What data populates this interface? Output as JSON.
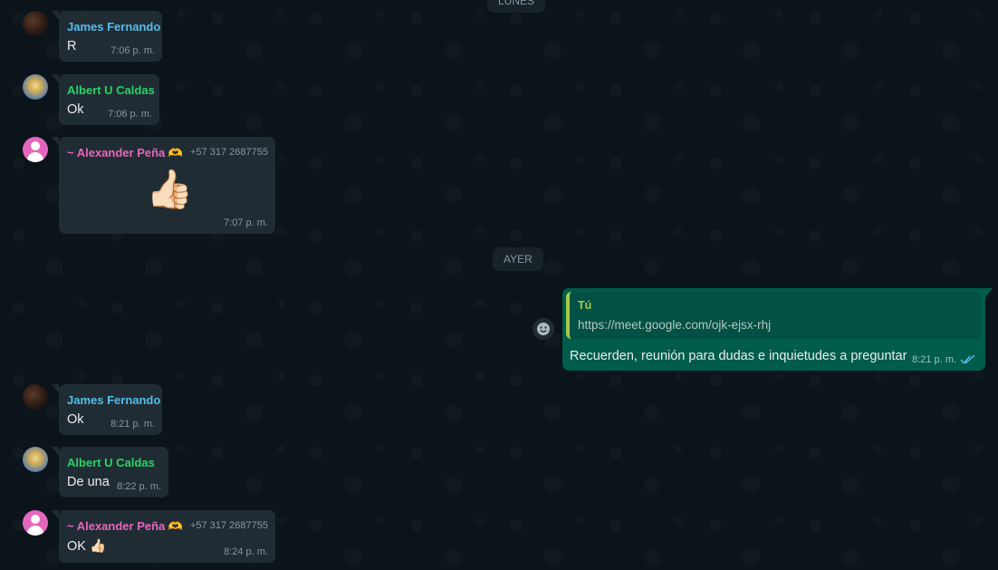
{
  "dividers": {
    "lunes": "LUNES",
    "ayer": "AYER"
  },
  "messages": [
    {
      "sender": "James Fernando",
      "text": "R",
      "time": "7:06 p. m."
    },
    {
      "sender": "Albert U Caldas",
      "text": "Ok",
      "time": "7:06 p. m."
    },
    {
      "sender": "~ Alexander Peña 🫶",
      "phone": "+57 317 2687755",
      "text": "👍🏻",
      "time": "7:07 p. m."
    },
    {
      "sender": "James Fernando",
      "text": "Ok",
      "time": "8:21 p. m."
    },
    {
      "sender": "Albert U Caldas",
      "text": "De una",
      "time": "8:22 p. m."
    },
    {
      "sender": "~ Alexander Peña 🫶",
      "phone": "+57 317 2687755",
      "text": "OK 👍🏻",
      "time": "8:24 p. m."
    }
  ],
  "outgoing": {
    "quote_author": "Tú",
    "quote_text": "https://meet.google.com/ojk-ejsx-rhj",
    "text": "Recuerden, reunión para dudas e inquietudes a preguntar",
    "time": "8:21 p. m."
  },
  "colors": {
    "james": "#53bdeb",
    "albert": "#25d366",
    "alexander": "#e567bd",
    "outgoing_bg": "#005c4b",
    "incoming_bg": "#202c33",
    "read_ticks": "#53bdeb"
  }
}
